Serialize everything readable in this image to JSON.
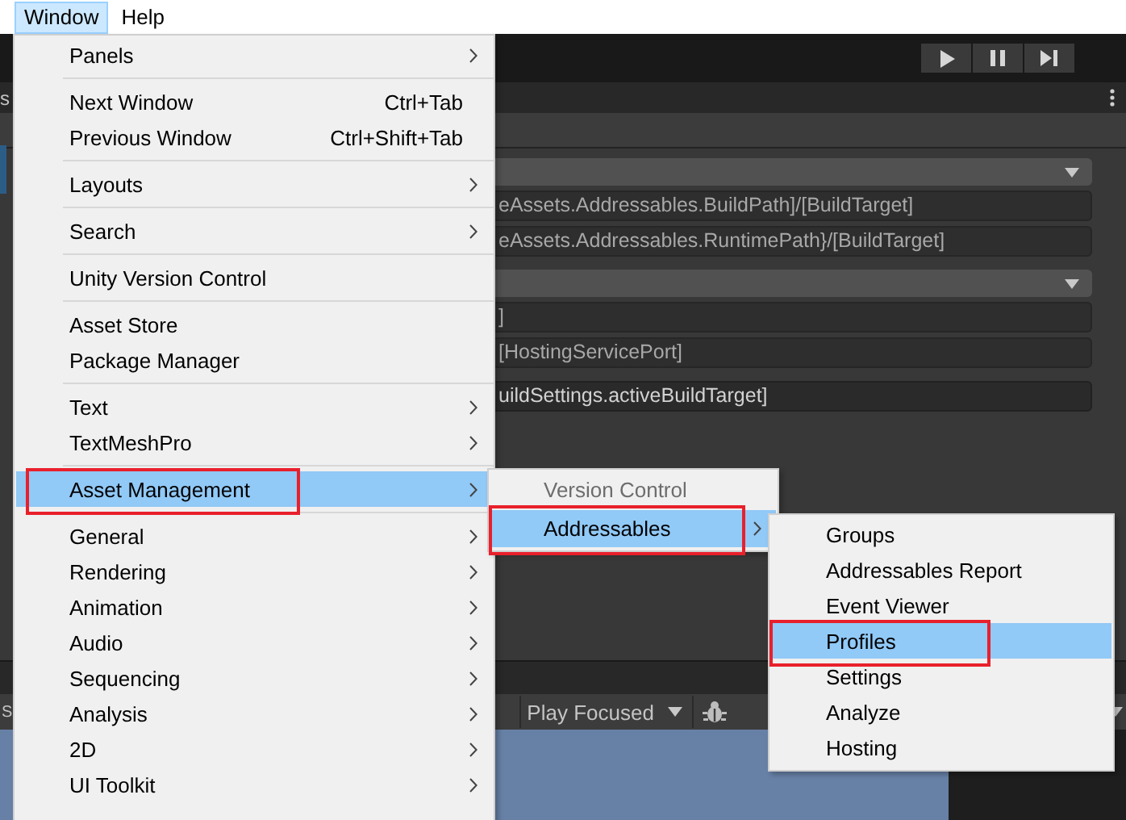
{
  "menubar": [
    {
      "label": "Window",
      "selected": true
    },
    {
      "label": "Help",
      "selected": false
    }
  ],
  "side_panel": {
    "label": "s"
  },
  "profile_fields": [
    {
      "kind": "dropdown"
    },
    {
      "kind": "text",
      "value": "eAssets.Addressables.BuildPath]/[BuildTarget]",
      "editable": false
    },
    {
      "kind": "text",
      "value": "eAssets.Addressables.RuntimePath}/[BuildTarget]",
      "editable": false
    },
    {
      "kind": "dropdown"
    },
    {
      "kind": "text",
      "value": "]",
      "editable": false
    },
    {
      "kind": "text",
      "value": "[HostingServicePort]",
      "editable": false
    },
    {
      "kind": "text",
      "value": "uildSettings.activeBuildTarget]",
      "editable": true
    }
  ],
  "game_toolbar": {
    "side_label": "S",
    "play_mode": "Play Focused"
  },
  "window_menu": {
    "groups": [
      [
        {
          "label": "Panels",
          "submenu": true,
          "selected": false,
          "annotated": false
        }
      ],
      [
        {
          "label": "Next Window",
          "shortcut": "Ctrl+Tab",
          "submenu": false,
          "selected": false,
          "annotated": false
        },
        {
          "label": "Previous Window",
          "shortcut": "Ctrl+Shift+Tab",
          "submenu": false,
          "selected": false,
          "annotated": false
        }
      ],
      [
        {
          "label": "Layouts",
          "submenu": true,
          "selected": false,
          "annotated": false
        }
      ],
      [
        {
          "label": "Search",
          "submenu": true,
          "selected": false,
          "annotated": false
        }
      ],
      [
        {
          "label": "Unity Version Control",
          "submenu": false,
          "selected": false,
          "annotated": false
        }
      ],
      [
        {
          "label": "Asset Store",
          "submenu": false,
          "selected": false,
          "annotated": false
        },
        {
          "label": "Package Manager",
          "submenu": false,
          "selected": false,
          "annotated": false
        }
      ],
      [
        {
          "label": "Text",
          "submenu": true,
          "selected": false,
          "annotated": false
        },
        {
          "label": "TextMeshPro",
          "submenu": true,
          "selected": false,
          "annotated": false
        }
      ],
      [
        {
          "label": "Asset Management",
          "submenu": true,
          "selected": true,
          "annotated": true
        }
      ],
      [
        {
          "label": "General",
          "submenu": true,
          "selected": false,
          "annotated": false
        },
        {
          "label": "Rendering",
          "submenu": true,
          "selected": false,
          "annotated": false
        },
        {
          "label": "Animation",
          "submenu": true,
          "selected": false,
          "annotated": false
        },
        {
          "label": "Audio",
          "submenu": true,
          "selected": false,
          "annotated": false
        },
        {
          "label": "Sequencing",
          "submenu": true,
          "selected": false,
          "annotated": false
        },
        {
          "label": "Analysis",
          "submenu": true,
          "selected": false,
          "annotated": false
        },
        {
          "label": "2D",
          "submenu": true,
          "selected": false,
          "annotated": false
        },
        {
          "label": "UI Toolkit",
          "submenu": true,
          "selected": false,
          "annotated": false
        }
      ]
    ]
  },
  "asset_management_menu": {
    "items": [
      {
        "label": "Version Control",
        "disabled": true,
        "submenu": false,
        "selected": false,
        "annotated": false
      },
      {
        "label": "Addressables",
        "disabled": false,
        "submenu": true,
        "selected": true,
        "annotated": true
      }
    ]
  },
  "addressables_menu": {
    "items": [
      {
        "label": "Groups",
        "selected": false,
        "annotated": false
      },
      {
        "label": "Addressables Report",
        "selected": false,
        "annotated": false
      },
      {
        "label": "Event Viewer",
        "selected": false,
        "annotated": false
      },
      {
        "label": "Profiles",
        "selected": true,
        "annotated": true
      },
      {
        "label": "Settings",
        "selected": false,
        "annotated": false
      },
      {
        "label": "Analyze",
        "selected": false,
        "annotated": false
      },
      {
        "label": "Hosting",
        "selected": false,
        "annotated": false
      }
    ]
  }
}
